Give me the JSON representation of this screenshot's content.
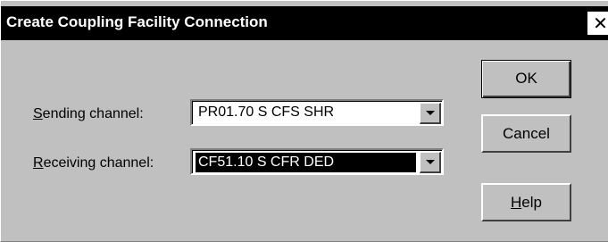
{
  "window": {
    "title": "Create Coupling Facility Connection",
    "close_glyph": "✕"
  },
  "form": {
    "sending": {
      "label_mnemonic": "S",
      "label_rest": "ending channel:",
      "value": "PR01.70 S CFS SHR"
    },
    "receiving": {
      "label_mnemonic": "R",
      "label_rest": "eceiving channel:",
      "value": "CF51.10 S CFR DED"
    }
  },
  "buttons": {
    "ok": "OK",
    "cancel": "Cancel",
    "help_mnemonic": "H",
    "help_rest": "elp"
  }
}
